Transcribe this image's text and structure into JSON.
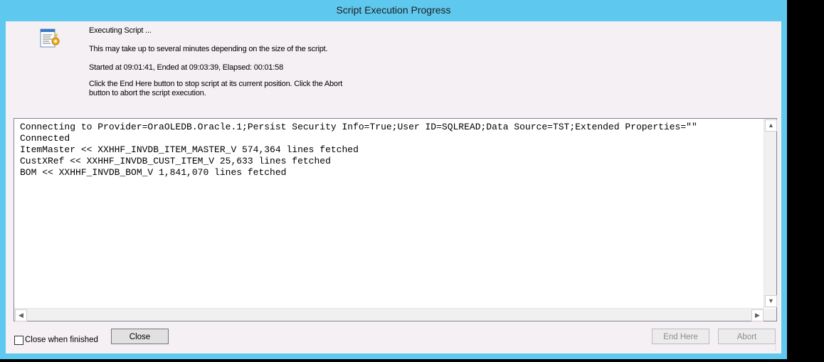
{
  "window": {
    "title": "Script Execution Progress"
  },
  "icons": {
    "script": "script-icon"
  },
  "status": {
    "executing": "Executing Script ...",
    "info": "This may take up to several minutes depending on the size of the script.",
    "timing": "Started at 09:01:41, Ended at 09:03:39,  Elapsed: 00:01:58",
    "instructions": "Click the End Here button to stop script at its current position. Click the Abort button to abort the script execution."
  },
  "log": {
    "lines": [
      "Connecting to Provider=OraOLEDB.Oracle.1;Persist Security Info=True;User ID=SQLREAD;Data Source=TST;Extended Properties=\"\"",
      "Connected",
      "ItemMaster << XXHHF_INVDB_ITEM_MASTER_V 574,364 lines fetched",
      "CustXRef << XXHHF_INVDB_CUST_ITEM_V 25,633 lines fetched",
      "BOM << XXHHF_INVDB_BOM_V 1,841,070 lines fetched"
    ]
  },
  "footer": {
    "close_when_finished_label": "Close when finished",
    "close_when_finished_checked": false,
    "close_label": "Close",
    "end_here_label": "End Here",
    "abort_label": "Abort"
  },
  "colors": {
    "titlebar": "#5ec8ef",
    "client_bg": "#f4f0f4"
  }
}
